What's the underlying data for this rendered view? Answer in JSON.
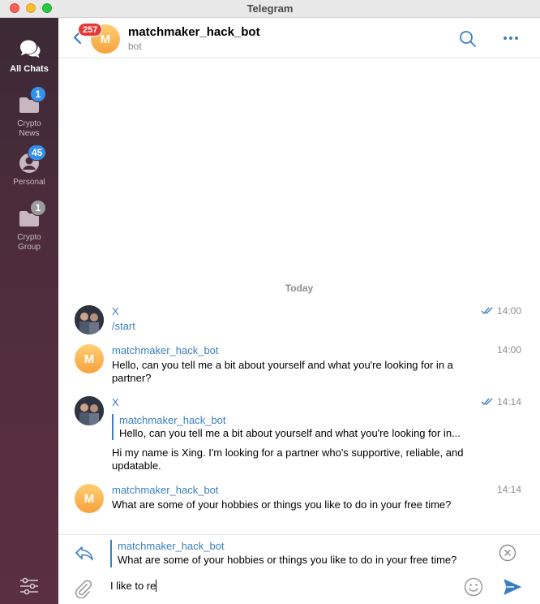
{
  "window": {
    "title": "Telegram"
  },
  "sidebar": {
    "folders": [
      {
        "label": "All Chats",
        "icon": "chats-icon",
        "badge": ""
      },
      {
        "label": "Crypto\nNews",
        "label_lines": [
          "Crypto",
          "News"
        ],
        "icon": "folder-icon",
        "badge": "1"
      },
      {
        "label_lines": [
          "Personal"
        ],
        "icon": "person-icon",
        "badge": "45"
      },
      {
        "label_lines": [
          "Crypto",
          "Group"
        ],
        "icon": "folder-icon",
        "badge": "1"
      }
    ],
    "settings_icon": "sliders-icon"
  },
  "header": {
    "back_badge": "257",
    "avatar_letter": "M",
    "chat_name": "matchmaker_hack_bot",
    "status": "bot"
  },
  "messages": {
    "date_separator": "Today",
    "items": [
      {
        "sender": "X",
        "time": "14:00",
        "text": "/start",
        "read": true
      },
      {
        "sender": "matchmaker_hack_bot",
        "avatar_letter": "M",
        "time": "14:00",
        "text": "Hello, can you tell me a bit about yourself and what you're looking for in a partner?"
      },
      {
        "sender": "X",
        "time": "14:14",
        "read": true,
        "quote_name": "matchmaker_hack_bot",
        "quote_text": "Hello, can you tell me a bit about yourself and what you're looking for in...",
        "text": "Hi my name is Xing. I'm looking for a partner who's supportive, reliable, and updatable."
      },
      {
        "sender": "matchmaker_hack_bot",
        "avatar_letter": "M",
        "time": "14:14",
        "text": "What are some of your hobbies or things you like to do in your free time?"
      }
    ]
  },
  "compose": {
    "reply_name": "matchmaker_hack_bot",
    "reply_text": "What are some of your hobbies or things you like to do in your free time?",
    "input_value": "I like to re"
  },
  "colors": {
    "accent": "#3a7fc1",
    "badge_red": "#e53935",
    "badge_blue": "#3390ec"
  }
}
